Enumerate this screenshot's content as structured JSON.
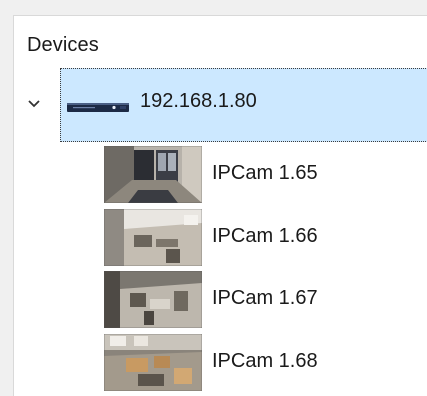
{
  "panel": {
    "title": "Devices"
  },
  "device": {
    "label": "192.168.1.80",
    "expanded": true,
    "selected": true,
    "icon": "nvr-recorder-icon"
  },
  "cameras": [
    {
      "label": "IPCam 1.65",
      "icon": "camera-thumbnail"
    },
    {
      "label": "IPCam 1.66",
      "icon": "camera-thumbnail"
    },
    {
      "label": "IPCam 1.67",
      "icon": "camera-thumbnail"
    },
    {
      "label": "IPCam 1.68",
      "icon": "camera-thumbnail"
    }
  ],
  "colors": {
    "selection": "#cce8ff",
    "panel_bg": "#ffffff",
    "window_bg": "#f0f0f0",
    "text": "#1a1a1a"
  }
}
